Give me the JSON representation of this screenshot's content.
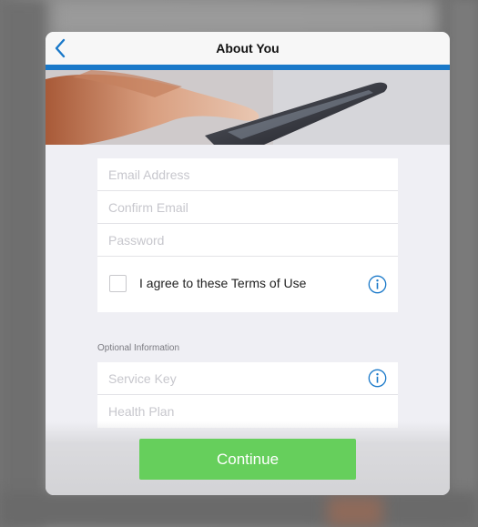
{
  "nav": {
    "title": "About You",
    "back_icon": "chevron-left-icon"
  },
  "form": {
    "email_placeholder": "Email Address",
    "email_value": "",
    "confirm_email_placeholder": "Confirm Email",
    "confirm_email_value": "",
    "password_placeholder": "Password",
    "password_value": "",
    "terms_label": "I agree to these Terms of Use",
    "terms_checked": false
  },
  "optional": {
    "section_title": "Optional Information",
    "service_key_placeholder": "Service Key",
    "service_key_value": "",
    "health_plan_placeholder": "Health Plan",
    "health_plan_value": ""
  },
  "actions": {
    "continue_label": "Continue"
  },
  "colors": {
    "accent_blue": "#1a79c9",
    "continue_green": "#66cf5c",
    "background_gray": "#efeff4"
  }
}
